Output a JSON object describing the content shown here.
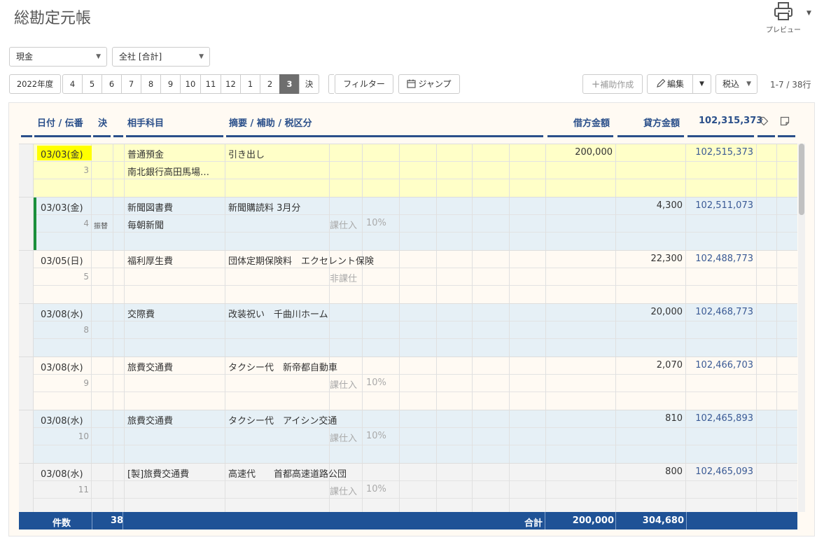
{
  "page": {
    "title": "総勘定元帳"
  },
  "toolbar": {
    "preview_label": "プレビュー"
  },
  "filters": {
    "account": "現金",
    "company": "全社 [合計]"
  },
  "period": {
    "year": "2022年度",
    "months": [
      "4",
      "5",
      "6",
      "7",
      "8",
      "9",
      "10",
      "11",
      "12",
      "1",
      "2",
      "3",
      "決"
    ],
    "active_month": "3"
  },
  "actions": {
    "filter": "フィルター",
    "jump": "ジャンプ",
    "create_aux": "補助作成",
    "edit": "編集",
    "tax_mode": "税込",
    "row_count": "1-7 / 38行"
  },
  "table": {
    "headers": {
      "date": "日付 / 伝番",
      "settle": "決",
      "counter": "相手科目",
      "memo": "摘要 / 補助 / 税区分",
      "debit": "借方金額",
      "credit": "貸方金額",
      "balance": "102,315,373"
    },
    "rows": [
      {
        "date": "03/03(金)",
        "no": "3",
        "tag": "",
        "account": "普通預金",
        "sub": "南北銀行高田馬場…",
        "memo": "引き出し",
        "tax": "",
        "rate": "",
        "debit": "200,000",
        "credit": "",
        "balance": "102,515,373"
      },
      {
        "date": "03/03(金)",
        "no": "4",
        "tag": "振替",
        "account": "新聞図書費",
        "sub": "毎朝新聞",
        "memo": "新聞購読料 3月分",
        "tax": "課仕入",
        "rate": "10%",
        "debit": "",
        "credit": "4,300",
        "balance": "102,511,073"
      },
      {
        "date": "03/05(日)",
        "no": "5",
        "tag": "",
        "account": "福利厚生費",
        "sub": "",
        "memo": "団体定期保険料　エクセレント保険",
        "tax": "非課仕",
        "rate": "",
        "debit": "",
        "credit": "22,300",
        "balance": "102,488,773"
      },
      {
        "date": "03/08(水)",
        "no": "8",
        "tag": "",
        "account": "交際費",
        "sub": "",
        "memo": "改装祝い　千曲川ホーム",
        "tax": "",
        "rate": "",
        "debit": "",
        "credit": "20,000",
        "balance": "102,468,773"
      },
      {
        "date": "03/08(水)",
        "no": "9",
        "tag": "",
        "account": "旅費交通費",
        "sub": "",
        "memo": "タクシー代　新帝都自動車",
        "tax": "課仕入",
        "rate": "10%",
        "debit": "",
        "credit": "2,070",
        "balance": "102,466,703"
      },
      {
        "date": "03/08(水)",
        "no": "10",
        "tag": "",
        "account": "旅費交通費",
        "sub": "",
        "memo": "タクシー代　アイシン交通",
        "tax": "課仕入",
        "rate": "10%",
        "debit": "",
        "credit": "810",
        "balance": "102,465,893"
      },
      {
        "date": "03/08(水)",
        "no": "11",
        "tag": "",
        "account": "[製]旅費交通費",
        "sub": "",
        "memo": "高速代　　首都高速道路公団",
        "tax": "課仕入",
        "rate": "10%",
        "debit": "",
        "credit": "800",
        "balance": "102,465,093"
      }
    ]
  },
  "footer": {
    "count_label": "件数",
    "count": "38",
    "total_label": "合計",
    "debit_total": "200,000",
    "credit_total": "304,680"
  }
}
